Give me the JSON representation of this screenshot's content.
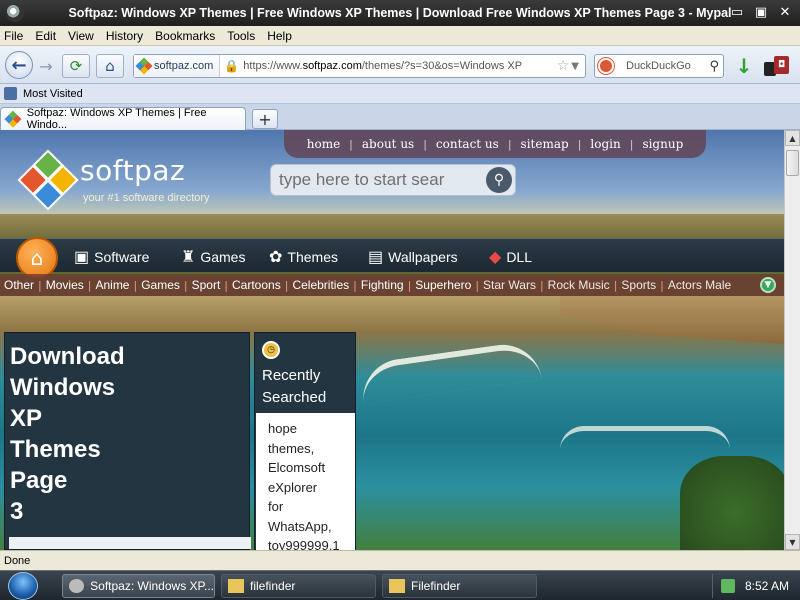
{
  "window": {
    "title": "Softpaz: Windows XP Themes | Free Windows XP Themes | Download Free Windows XP Themes Page 3 - Mypal",
    "controls": {
      "minimize": "▭",
      "restore": "▣",
      "close": "✕"
    }
  },
  "menu": [
    "File",
    "Edit",
    "View",
    "History",
    "Bookmarks",
    "Tools",
    "Help"
  ],
  "nav": {
    "identity": "softpaz.com",
    "url_prefix": "https://www.",
    "url_domain": "softpaz.com",
    "url_path": "/themes/?s=30&os=Windows XP",
    "search_engine": "DuckDuckGo",
    "icons": {
      "back": "back-arrow-icon",
      "forward": "forward-arrow-icon",
      "reload": "reload-icon",
      "home": "home-icon",
      "lock": "lock-icon",
      "star": "bookmark-star-icon",
      "search": "magnifier-icon",
      "download": "download-arrow-icon"
    }
  },
  "bookmarks": {
    "most_visited": "Most Visited"
  },
  "tabs": [
    {
      "label": "Softpaz: Windows XP Themes | Free Windo..."
    }
  ],
  "page": {
    "toplinks": [
      "home",
      "about us",
      "contact us",
      "sitemap",
      "login",
      "signup"
    ],
    "logo": {
      "name": "softpaz",
      "tagline": "your #1 software directory"
    },
    "search_placeholder": "type here to start sear",
    "mainnav": [
      "Software",
      "Games",
      "Themes",
      "Wallpapers",
      "DLL"
    ],
    "categories": [
      "Other",
      "Movies",
      "Anime",
      "Games",
      "Sport",
      "Cartoons",
      "Celebrities",
      "Fighting",
      "Superhero",
      "Star Wars",
      "Rock Music",
      "Sports",
      "Actors Male"
    ],
    "heading": "Download\nWindows\nXP\nThemes\nPage\n3",
    "recent_title": "Recently\nSearched",
    "recent_items": "hope\nthemes,\nElcomsoft\neXplorer\nfor\nWhatsApp,\ntoy999999.1"
  },
  "status": "Done",
  "taskbar": {
    "tasks": [
      {
        "label": "Softpaz: Windows XP...",
        "active": true
      },
      {
        "label": "filefinder",
        "active": false
      },
      {
        "label": "Filefinder",
        "active": false
      }
    ],
    "clock": "8:52 AM"
  },
  "colors": {
    "title_bar": "#2b2b2b",
    "site_toplinks_bg": "#624856",
    "site_nav_bg": "#1c2832",
    "site_category_bg": "#6e3732",
    "site_panel_bg": "#233541",
    "home_orb": "#e5770f"
  }
}
